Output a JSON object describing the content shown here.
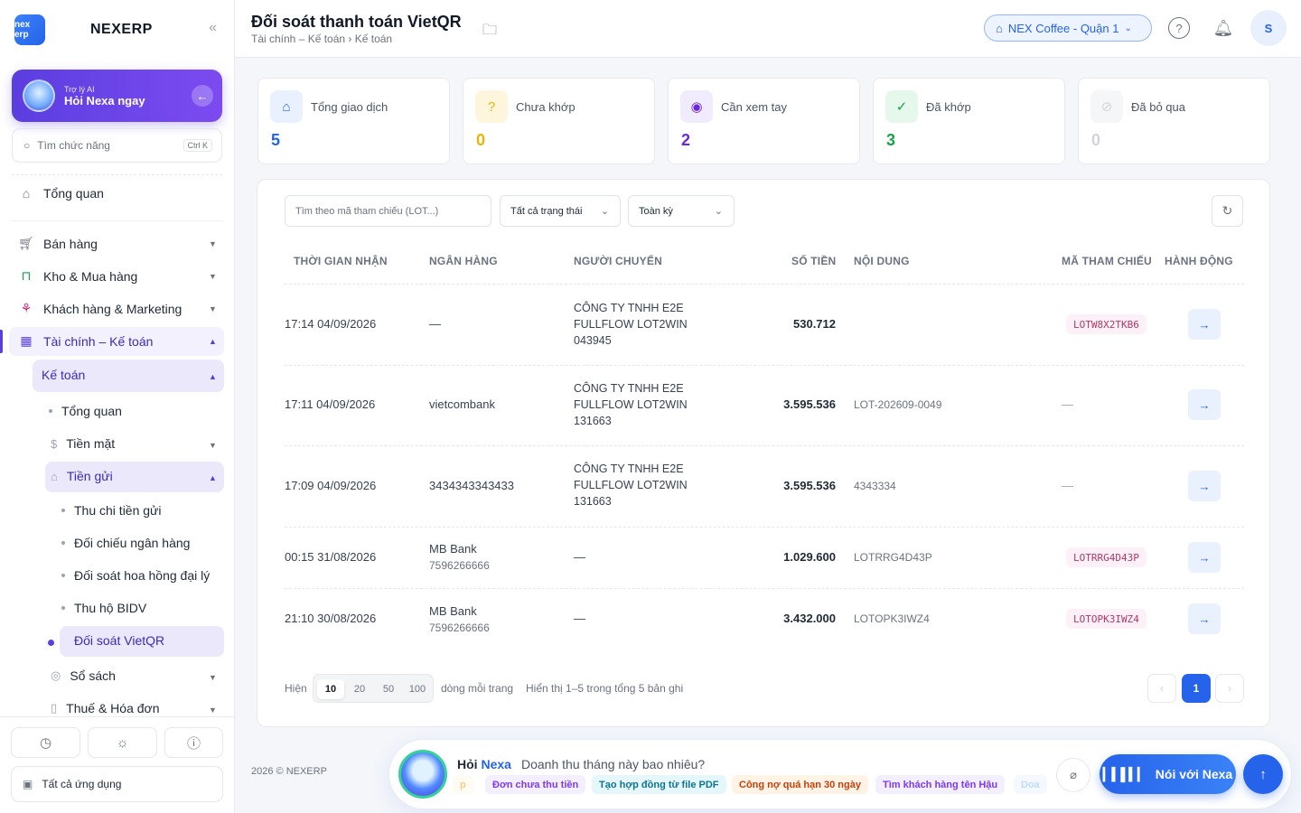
{
  "sidebar": {
    "logo_text": "nex erp",
    "brand": "NEXERP",
    "ai_card": {
      "sub": "Trợ lý AI",
      "main": "Hỏi Nexa ngay"
    },
    "search": {
      "placeholder": "Tìm chức năng",
      "shortcut": "Ctrl K"
    },
    "items": [
      {
        "label": "Tổng quan",
        "icon": "home-icon"
      },
      {
        "label": "Bán hàng",
        "icon": "cart-icon"
      },
      {
        "label": "Kho & Mua hàng",
        "icon": "bag-icon"
      },
      {
        "label": "Khách hàng & Marketing",
        "icon": "users-icon"
      },
      {
        "label": "Tài chính – Kế toán",
        "icon": "calculator-icon"
      }
    ],
    "sub": {
      "ke_toan": "Kế toán",
      "tong_quan": "Tổng quan",
      "tien_mat": "Tiền mặt",
      "tien_gui": "Tiền gửi",
      "deposit_items": [
        "Thu chi tiền gửi",
        "Đối chiếu ngân hàng",
        "Đối soát hoa hồng đại lý",
        "Thu hộ BIDV",
        "Đối soát VietQR"
      ],
      "so_sach": "Sổ sách",
      "thue": "Thuế & Hóa đơn"
    },
    "all_apps": "Tất cả ứng dụng"
  },
  "header": {
    "title": "Đối soát thanh toán VietQR",
    "breadcrumb": "Tài chính – Kế toán › Kế toán",
    "store": "NEX Coffee - Quận 1",
    "avatar": "S"
  },
  "stats": [
    {
      "label": "Tổng giao dịch",
      "value": "5",
      "color": "#2563eb",
      "bg": "#e8f1fd",
      "icon": "bank-icon"
    },
    {
      "label": "Chưa khớp",
      "value": "0",
      "color": "#eab308",
      "bg": "#fef6dc",
      "icon": "question-icon"
    },
    {
      "label": "Cần xem tay",
      "value": "2",
      "color": "#6d28d9",
      "bg": "#f1ecfd",
      "icon": "eye-icon"
    },
    {
      "label": "Đã khớp",
      "value": "3",
      "color": "#16a34a",
      "bg": "#e6f7ec",
      "icon": "check-icon"
    },
    {
      "label": "Đã bỏ qua",
      "value": "0",
      "color": "#d1d5db",
      "bg": "#f5f6f8",
      "icon": "skip-icon"
    }
  ],
  "filters": {
    "search_placeholder": "Tìm theo mã tham chiếu (LOT...)",
    "status": "Tất cả trạng thái",
    "period": "Toàn kỳ"
  },
  "table": {
    "columns": [
      "THỜI GIAN NHẬN",
      "NGÂN HÀNG",
      "NGƯỜI CHUYỂN",
      "SỐ TIỀN",
      "NỘI DUNG",
      "MÃ THAM CHIẾU",
      "HÀNH ĐỘNG"
    ],
    "rows": [
      {
        "time": "17:14 04/09/2026",
        "bank": "—",
        "bank_acc": "",
        "sender": [
          "CÔNG TY TNHH E2E",
          "FULLFLOW LOT2WIN",
          "043945"
        ],
        "amount": "530.712",
        "content": "",
        "ref": "LOTW8X2TKB6"
      },
      {
        "time": "17:11 04/09/2026",
        "bank": "vietcombank",
        "bank_acc": "",
        "sender": [
          "CÔNG TY TNHH E2E",
          "FULLFLOW LOT2WIN",
          "131663"
        ],
        "amount": "3.595.536",
        "content": "LOT-202609-0049",
        "ref": "—"
      },
      {
        "time": "17:09 04/09/2026",
        "bank": "3434343343433",
        "bank_acc": "",
        "sender": [
          "CÔNG TY TNHH E2E",
          "FULLFLOW LOT2WIN",
          "131663"
        ],
        "amount": "3.595.536",
        "content": "4343334",
        "ref": "—"
      },
      {
        "time": "00:15 31/08/2026",
        "bank": "MB Bank",
        "bank_acc": "7596266666",
        "sender": [
          "—"
        ],
        "amount": "1.029.600",
        "content": "LOTRRG4D43P",
        "ref": "LOTRRG4D43P"
      },
      {
        "time": "21:10 30/08/2026",
        "bank": "MB Bank",
        "bank_acc": "7596266666",
        "sender": [
          "—"
        ],
        "amount": "3.432.000",
        "content": "LOTOPK3IWZ4",
        "ref": "LOTOPK3IWZ4"
      }
    ]
  },
  "pagination": {
    "show_label": "Hiện",
    "sizes": [
      "10",
      "20",
      "50",
      "100"
    ],
    "active_size": "10",
    "per_page_label": "dòng mỗi trang",
    "summary": "Hiển thị 1–5 trong tổng 5 bản ghi",
    "current_page": "1"
  },
  "footer": {
    "copyright": "2026 © NEXERP",
    "nexa_prefix": "Hỏi",
    "nexa_name": "Nexa",
    "question": "Doanh thu tháng này bao nhiêu?",
    "chips": [
      {
        "label": "p",
        "color": "#f59e0b",
        "bg": "#fff7e6"
      },
      {
        "label": "Đơn chưa thu tiền",
        "color": "#7c3aed",
        "bg": "#f3efff"
      },
      {
        "label": "Tạo hợp đồng từ file PDF",
        "color": "#0e7490",
        "bg": "#e6f7fb"
      },
      {
        "label": "Công nợ quá hạn 30 ngày",
        "color": "#c2410c",
        "bg": "#fff3e6"
      },
      {
        "label": "Tìm khách hàng tên Hậu",
        "color": "#7c3aed",
        "bg": "#f3efff"
      },
      {
        "label": "Doa",
        "color": "#93c5fd",
        "bg": "#f0f6ff"
      }
    ],
    "talk_label": "Nói với Nexa"
  }
}
